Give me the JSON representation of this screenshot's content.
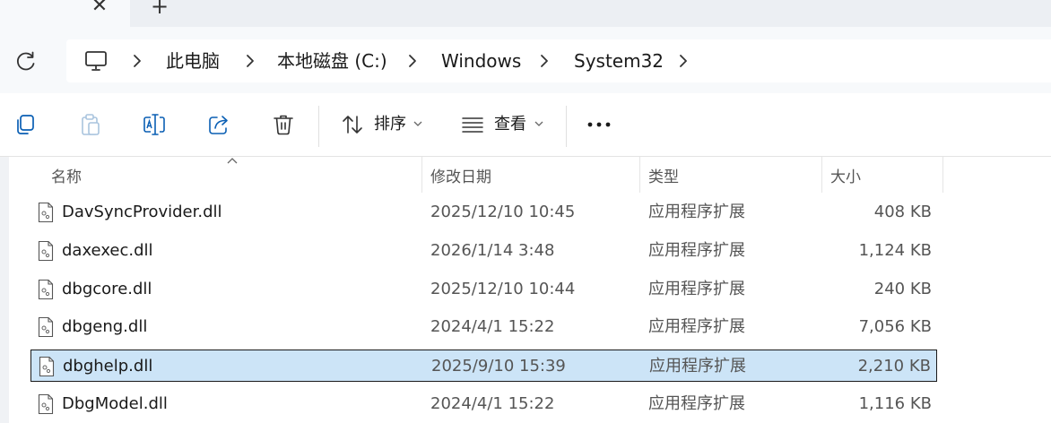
{
  "tab": {
    "close_glyph": "✕",
    "new_glyph": "+"
  },
  "breadcrumb": {
    "items": [
      "此电脑",
      "本地磁盘 (C:)",
      "Windows",
      "System32"
    ]
  },
  "toolbar": {
    "sort_label": "排序",
    "view_label": "查看",
    "more_glyph": "⋯"
  },
  "columns": {
    "name": "名称",
    "date": "修改日期",
    "type": "类型",
    "size": "大小"
  },
  "files": [
    {
      "name": "DavSyncProvider.dll",
      "date": "2025/12/10 10:45",
      "type": "应用程序扩展",
      "size": "408 KB",
      "selected": false
    },
    {
      "name": "daxexec.dll",
      "date": "2026/1/14 3:48",
      "type": "应用程序扩展",
      "size": "1,124 KB",
      "selected": false
    },
    {
      "name": "dbgcore.dll",
      "date": "2025/12/10 10:44",
      "type": "应用程序扩展",
      "size": "240 KB",
      "selected": false
    },
    {
      "name": "dbgeng.dll",
      "date": "2024/4/1 15:22",
      "type": "应用程序扩展",
      "size": "7,056 KB",
      "selected": false
    },
    {
      "name": "dbghelp.dll",
      "date": "2025/9/10 15:39",
      "type": "应用程序扩展",
      "size": "2,210 KB",
      "selected": true
    },
    {
      "name": "DbgModel.dll",
      "date": "2024/4/1 15:22",
      "type": "应用程序扩展",
      "size": "1,116 KB",
      "selected": false
    }
  ],
  "colors": {
    "selection_bg": "#cce4f7",
    "accent": "#0a5fb4"
  }
}
